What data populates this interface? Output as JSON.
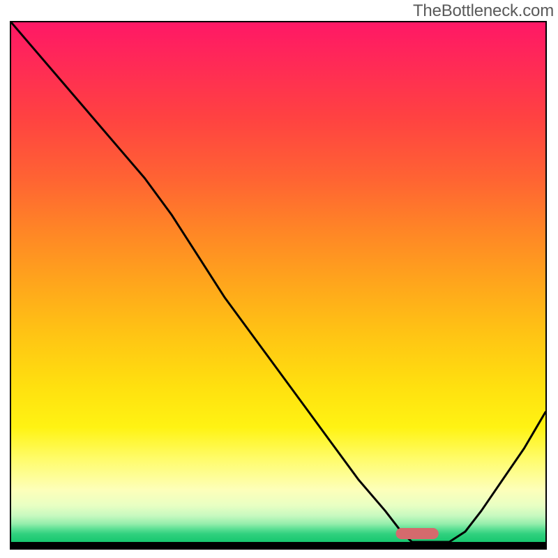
{
  "watermark": "TheBottleneck.com",
  "chart_data": {
    "type": "line",
    "title": "",
    "xlabel": "",
    "ylabel": "",
    "xlim": [
      0,
      100
    ],
    "ylim": [
      0,
      100
    ],
    "grid": false,
    "legend": false,
    "series": [
      {
        "name": "bottleneck-curve",
        "x": [
          0,
          5,
          10,
          15,
          20,
          25,
          30,
          35,
          40,
          45,
          50,
          55,
          60,
          65,
          70,
          73,
          75,
          78,
          80,
          82,
          85,
          88,
          92,
          96,
          100
        ],
        "y": [
          100,
          94,
          88,
          82,
          76,
          70,
          63,
          55,
          47,
          40,
          33,
          26,
          19,
          12,
          6,
          2,
          0,
          0,
          0,
          0,
          2,
          6,
          12,
          18,
          25
        ]
      }
    ],
    "marker": {
      "name": "optimal-pill",
      "x_start": 72,
      "x_end": 80,
      "y": 0,
      "color": "#d46a6d"
    },
    "background_gradient": {
      "stops": [
        {
          "pct": 0,
          "color": "#ff1866"
        },
        {
          "pct": 18,
          "color": "#ff4142"
        },
        {
          "pct": 40,
          "color": "#ff8526"
        },
        {
          "pct": 60,
          "color": "#ffc414"
        },
        {
          "pct": 78,
          "color": "#fff313"
        },
        {
          "pct": 90,
          "color": "#fdffba"
        },
        {
          "pct": 95,
          "color": "#c6f9bf"
        },
        {
          "pct": 100,
          "color": "#18c86f"
        }
      ]
    }
  }
}
